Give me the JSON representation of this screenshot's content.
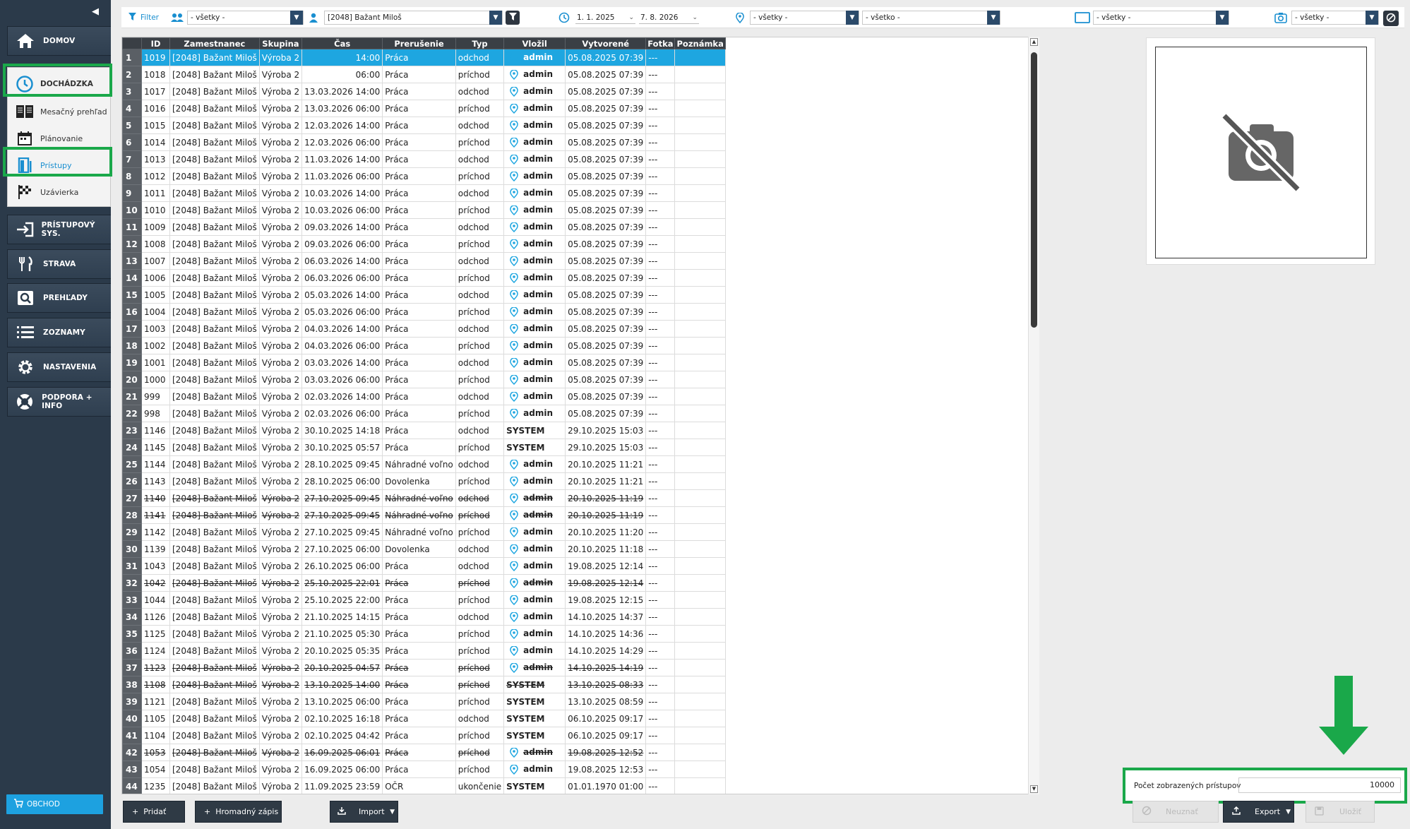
{
  "sidebar": {
    "collapse_glyph": "◀",
    "domov": "DOMOV",
    "dochadzka": "DOCHÁDZKA",
    "sub": [
      "Mesačný prehľad",
      "Plánovanie",
      "Prístupy",
      "Uzávierka"
    ],
    "pristupovy": "PRÍSTUPOVÝ SYS.",
    "strava": "STRAVA",
    "prehlady": "PREHĽADY",
    "zoznamy": "ZOZNAMY",
    "nastavenia": "NASTAVENIA",
    "podpora": "PODPORA + INFO",
    "obchod": "OBCHOD"
  },
  "filter": {
    "label": "Filter",
    "group": "- všetky -",
    "employee": "[2048] Bažant Miloš",
    "date_from": "1. 1. 2025",
    "date_to": "7. 8. 2026",
    "location": "- všetky -",
    "all": "- všetko -",
    "terminal": "- všetky -",
    "photo": "- všetky -"
  },
  "table": {
    "headers": [
      "ID",
      "Zamestnanec",
      "Skupina",
      "Čas",
      "Prerušenie",
      "Typ",
      "Vložil",
      "Vytvorené",
      "Fotka",
      "Poznámka"
    ],
    "rows": [
      {
        "n": "1",
        "id": "1019",
        "emp": "[2048] Bažant Miloš",
        "grp": "Výroba 2",
        "time": "14:00",
        "brk": "Práca",
        "typ": "odchod",
        "by": "admin",
        "created": "05.08.2025 07:39",
        "foto": "---",
        "sel": true
      },
      {
        "n": "2",
        "id": "1018",
        "emp": "[2048] Bažant Miloš",
        "grp": "Výroba 2",
        "time": "06:00",
        "brk": "Práca",
        "typ": "príchod",
        "by": "admin",
        "created": "05.08.2025 07:39",
        "foto": "---"
      },
      {
        "n": "3",
        "id": "1017",
        "emp": "[2048] Bažant Miloš",
        "grp": "Výroba 2",
        "time": "13.03.2026 14:00",
        "brk": "Práca",
        "typ": "odchod",
        "by": "admin",
        "created": "05.08.2025 07:39",
        "foto": "---"
      },
      {
        "n": "4",
        "id": "1016",
        "emp": "[2048] Bažant Miloš",
        "grp": "Výroba 2",
        "time": "13.03.2026 06:00",
        "brk": "Práca",
        "typ": "príchod",
        "by": "admin",
        "created": "05.08.2025 07:39",
        "foto": "---"
      },
      {
        "n": "5",
        "id": "1015",
        "emp": "[2048] Bažant Miloš",
        "grp": "Výroba 2",
        "time": "12.03.2026 14:00",
        "brk": "Práca",
        "typ": "odchod",
        "by": "admin",
        "created": "05.08.2025 07:39",
        "foto": "---"
      },
      {
        "n": "6",
        "id": "1014",
        "emp": "[2048] Bažant Miloš",
        "grp": "Výroba 2",
        "time": "12.03.2026 06:00",
        "brk": "Práca",
        "typ": "príchod",
        "by": "admin",
        "created": "05.08.2025 07:39",
        "foto": "---"
      },
      {
        "n": "7",
        "id": "1013",
        "emp": "[2048] Bažant Miloš",
        "grp": "Výroba 2",
        "time": "11.03.2026 14:00",
        "brk": "Práca",
        "typ": "odchod",
        "by": "admin",
        "created": "05.08.2025 07:39",
        "foto": "---"
      },
      {
        "n": "8",
        "id": "1012",
        "emp": "[2048] Bažant Miloš",
        "grp": "Výroba 2",
        "time": "11.03.2026 06:00",
        "brk": "Práca",
        "typ": "príchod",
        "by": "admin",
        "created": "05.08.2025 07:39",
        "foto": "---"
      },
      {
        "n": "9",
        "id": "1011",
        "emp": "[2048] Bažant Miloš",
        "grp": "Výroba 2",
        "time": "10.03.2026 14:00",
        "brk": "Práca",
        "typ": "odchod",
        "by": "admin",
        "created": "05.08.2025 07:39",
        "foto": "---"
      },
      {
        "n": "10",
        "id": "1010",
        "emp": "[2048] Bažant Miloš",
        "grp": "Výroba 2",
        "time": "10.03.2026 06:00",
        "brk": "Práca",
        "typ": "príchod",
        "by": "admin",
        "created": "05.08.2025 07:39",
        "foto": "---"
      },
      {
        "n": "11",
        "id": "1009",
        "emp": "[2048] Bažant Miloš",
        "grp": "Výroba 2",
        "time": "09.03.2026 14:00",
        "brk": "Práca",
        "typ": "odchod",
        "by": "admin",
        "created": "05.08.2025 07:39",
        "foto": "---"
      },
      {
        "n": "12",
        "id": "1008",
        "emp": "[2048] Bažant Miloš",
        "grp": "Výroba 2",
        "time": "09.03.2026 06:00",
        "brk": "Práca",
        "typ": "príchod",
        "by": "admin",
        "created": "05.08.2025 07:39",
        "foto": "---"
      },
      {
        "n": "13",
        "id": "1007",
        "emp": "[2048] Bažant Miloš",
        "grp": "Výroba 2",
        "time": "06.03.2026 14:00",
        "brk": "Práca",
        "typ": "odchod",
        "by": "admin",
        "created": "05.08.2025 07:39",
        "foto": "---"
      },
      {
        "n": "14",
        "id": "1006",
        "emp": "[2048] Bažant Miloš",
        "grp": "Výroba 2",
        "time": "06.03.2026 06:00",
        "brk": "Práca",
        "typ": "príchod",
        "by": "admin",
        "created": "05.08.2025 07:39",
        "foto": "---"
      },
      {
        "n": "15",
        "id": "1005",
        "emp": "[2048] Bažant Miloš",
        "grp": "Výroba 2",
        "time": "05.03.2026 14:00",
        "brk": "Práca",
        "typ": "odchod",
        "by": "admin",
        "created": "05.08.2025 07:39",
        "foto": "---"
      },
      {
        "n": "16",
        "id": "1004",
        "emp": "[2048] Bažant Miloš",
        "grp": "Výroba 2",
        "time": "05.03.2026 06:00",
        "brk": "Práca",
        "typ": "príchod",
        "by": "admin",
        "created": "05.08.2025 07:39",
        "foto": "---"
      },
      {
        "n": "17",
        "id": "1003",
        "emp": "[2048] Bažant Miloš",
        "grp": "Výroba 2",
        "time": "04.03.2026 14:00",
        "brk": "Práca",
        "typ": "odchod",
        "by": "admin",
        "created": "05.08.2025 07:39",
        "foto": "---"
      },
      {
        "n": "18",
        "id": "1002",
        "emp": "[2048] Bažant Miloš",
        "grp": "Výroba 2",
        "time": "04.03.2026 06:00",
        "brk": "Práca",
        "typ": "príchod",
        "by": "admin",
        "created": "05.08.2025 07:39",
        "foto": "---"
      },
      {
        "n": "19",
        "id": "1001",
        "emp": "[2048] Bažant Miloš",
        "grp": "Výroba 2",
        "time": "03.03.2026 14:00",
        "brk": "Práca",
        "typ": "odchod",
        "by": "admin",
        "created": "05.08.2025 07:39",
        "foto": "---"
      },
      {
        "n": "20",
        "id": "1000",
        "emp": "[2048] Bažant Miloš",
        "grp": "Výroba 2",
        "time": "03.03.2026 06:00",
        "brk": "Práca",
        "typ": "príchod",
        "by": "admin",
        "created": "05.08.2025 07:39",
        "foto": "---"
      },
      {
        "n": "21",
        "id": "999",
        "emp": "[2048] Bažant Miloš",
        "grp": "Výroba 2",
        "time": "02.03.2026 14:00",
        "brk": "Práca",
        "typ": "odchod",
        "by": "admin",
        "created": "05.08.2025 07:39",
        "foto": "---"
      },
      {
        "n": "22",
        "id": "998",
        "emp": "[2048] Bažant Miloš",
        "grp": "Výroba 2",
        "time": "02.03.2026 06:00",
        "brk": "Práca",
        "typ": "príchod",
        "by": "admin",
        "created": "05.08.2025 07:39",
        "foto": "---"
      },
      {
        "n": "23",
        "id": "1146",
        "emp": "[2048] Bažant Miloš",
        "grp": "Výroba 2",
        "time": "30.10.2025 14:18",
        "brk": "Práca",
        "typ": "odchod",
        "by": "SYSTEM",
        "created": "29.10.2025 15:03",
        "foto": "---"
      },
      {
        "n": "24",
        "id": "1145",
        "emp": "[2048] Bažant Miloš",
        "grp": "Výroba 2",
        "time": "30.10.2025 05:57",
        "brk": "Práca",
        "typ": "príchod",
        "by": "SYSTEM",
        "created": "29.10.2025 15:03",
        "foto": "---"
      },
      {
        "n": "25",
        "id": "1144",
        "emp": "[2048] Bažant Miloš",
        "grp": "Výroba 2",
        "time": "28.10.2025 09:45",
        "brk": "Náhradné voľno",
        "typ": "odchod",
        "by": "admin",
        "created": "20.10.2025 11:21",
        "foto": "---"
      },
      {
        "n": "26",
        "id": "1143",
        "emp": "[2048] Bažant Miloš",
        "grp": "Výroba 2",
        "time": "28.10.2025 06:00",
        "brk": "Dovolenka",
        "typ": "príchod",
        "by": "admin",
        "created": "20.10.2025 11:21",
        "foto": "---"
      },
      {
        "n": "27",
        "id": "1140",
        "emp": "[2048] Bažant Miloš",
        "grp": "Výroba 2",
        "time": "27.10.2025 09:45",
        "brk": "Náhradné voľno",
        "typ": "odchod",
        "by": "admin",
        "created": "20.10.2025 11:19",
        "foto": "---",
        "del": true
      },
      {
        "n": "28",
        "id": "1141",
        "emp": "[2048] Bažant Miloš",
        "grp": "Výroba 2",
        "time": "27.10.2025 09:45",
        "brk": "Náhradné voľno",
        "typ": "príchod",
        "by": "admin",
        "created": "20.10.2025 11:19",
        "foto": "---",
        "del": true
      },
      {
        "n": "29",
        "id": "1142",
        "emp": "[2048] Bažant Miloš",
        "grp": "Výroba 2",
        "time": "27.10.2025 09:45",
        "brk": "Náhradné voľno",
        "typ": "príchod",
        "by": "admin",
        "created": "20.10.2025 11:20",
        "foto": "---"
      },
      {
        "n": "30",
        "id": "1139",
        "emp": "[2048] Bažant Miloš",
        "grp": "Výroba 2",
        "time": "27.10.2025 06:00",
        "brk": "Dovolenka",
        "typ": "odchod",
        "by": "admin",
        "created": "20.10.2025 11:18",
        "foto": "---"
      },
      {
        "n": "31",
        "id": "1043",
        "emp": "[2048] Bažant Miloš",
        "grp": "Výroba 2",
        "time": "26.10.2025 06:00",
        "brk": "Práca",
        "typ": "odchod",
        "by": "admin",
        "created": "19.08.2025 12:14",
        "foto": "---"
      },
      {
        "n": "32",
        "id": "1042",
        "emp": "[2048] Bažant Miloš",
        "grp": "Výroba 2",
        "time": "25.10.2025 22:01",
        "brk": "Práca",
        "typ": "príchod",
        "by": "admin",
        "created": "19.08.2025 12:14",
        "foto": "---",
        "del": true
      },
      {
        "n": "33",
        "id": "1044",
        "emp": "[2048] Bažant Miloš",
        "grp": "Výroba 2",
        "time": "25.10.2025 22:00",
        "brk": "Práca",
        "typ": "príchod",
        "by": "admin",
        "created": "19.08.2025 12:15",
        "foto": "---"
      },
      {
        "n": "34",
        "id": "1126",
        "emp": "[2048] Bažant Miloš",
        "grp": "Výroba 2",
        "time": "21.10.2025 14:15",
        "brk": "Práca",
        "typ": "odchod",
        "by": "admin",
        "created": "14.10.2025 14:37",
        "foto": "---"
      },
      {
        "n": "35",
        "id": "1125",
        "emp": "[2048] Bažant Miloš",
        "grp": "Výroba 2",
        "time": "21.10.2025 05:30",
        "brk": "Práca",
        "typ": "príchod",
        "by": "admin",
        "created": "14.10.2025 14:36",
        "foto": "---"
      },
      {
        "n": "36",
        "id": "1124",
        "emp": "[2048] Bažant Miloš",
        "grp": "Výroba 2",
        "time": "20.10.2025 05:35",
        "brk": "Práca",
        "typ": "príchod",
        "by": "admin",
        "created": "14.10.2025 14:29",
        "foto": "---"
      },
      {
        "n": "37",
        "id": "1123",
        "emp": "[2048] Bažant Miloš",
        "grp": "Výroba 2",
        "time": "20.10.2025 04:57",
        "brk": "Práca",
        "typ": "príchod",
        "by": "admin",
        "created": "14.10.2025 14:19",
        "foto": "---",
        "del": true
      },
      {
        "n": "38",
        "id": "1108",
        "emp": "[2048] Bažant Miloš",
        "grp": "Výroba 2",
        "time": "13.10.2025 14:00",
        "brk": "Práca",
        "typ": "príchod",
        "by": "SYSTEM",
        "created": "13.10.2025 08:33",
        "foto": "---",
        "del": true
      },
      {
        "n": "39",
        "id": "1121",
        "emp": "[2048] Bažant Miloš",
        "grp": "Výroba 2",
        "time": "13.10.2025 06:00",
        "brk": "Práca",
        "typ": "príchod",
        "by": "SYSTEM",
        "created": "13.10.2025 08:59",
        "foto": "---"
      },
      {
        "n": "40",
        "id": "1105",
        "emp": "[2048] Bažant Miloš",
        "grp": "Výroba 2",
        "time": "02.10.2025 16:18",
        "brk": "Práca",
        "typ": "odchod",
        "by": "SYSTEM",
        "created": "06.10.2025 09:17",
        "foto": "---"
      },
      {
        "n": "41",
        "id": "1104",
        "emp": "[2048] Bažant Miloš",
        "grp": "Výroba 2",
        "time": "02.10.2025 04:42",
        "brk": "Práca",
        "typ": "príchod",
        "by": "SYSTEM",
        "created": "06.10.2025 09:17",
        "foto": "---"
      },
      {
        "n": "42",
        "id": "1053",
        "emp": "[2048] Bažant Miloš",
        "grp": "Výroba 2",
        "time": "16.09.2025 06:01",
        "brk": "Práca",
        "typ": "príchod",
        "by": "admin",
        "created": "19.08.2025 12:52",
        "foto": "---",
        "del": true
      },
      {
        "n": "43",
        "id": "1054",
        "emp": "[2048] Bažant Miloš",
        "grp": "Výroba 2",
        "time": "16.09.2025 06:00",
        "brk": "Práca",
        "typ": "príchod",
        "by": "admin",
        "created": "19.08.2025 12:53",
        "foto": "---"
      },
      {
        "n": "44",
        "id": "1235",
        "emp": "[2048] Bažant Miloš",
        "grp": "Výroba 2",
        "time": "11.09.2025 23:59",
        "brk": "OČR",
        "typ": "ukončenie",
        "by": "SYSTEM",
        "created": "01.01.1970 01:00",
        "foto": "---"
      }
    ]
  },
  "count": {
    "label": "Počet zobrazených prístupov",
    "value": "10000"
  },
  "toolbar": {
    "add": "Pridať",
    "bulk": "Hromadný zápis",
    "import": "Import",
    "reject": "Neuznať",
    "export": "Export",
    "save": "Uložiť"
  },
  "colors": {
    "accent": "#1ea6e0",
    "highlight_green": "#1aa84a",
    "sidebar": "#2b3a4a"
  }
}
